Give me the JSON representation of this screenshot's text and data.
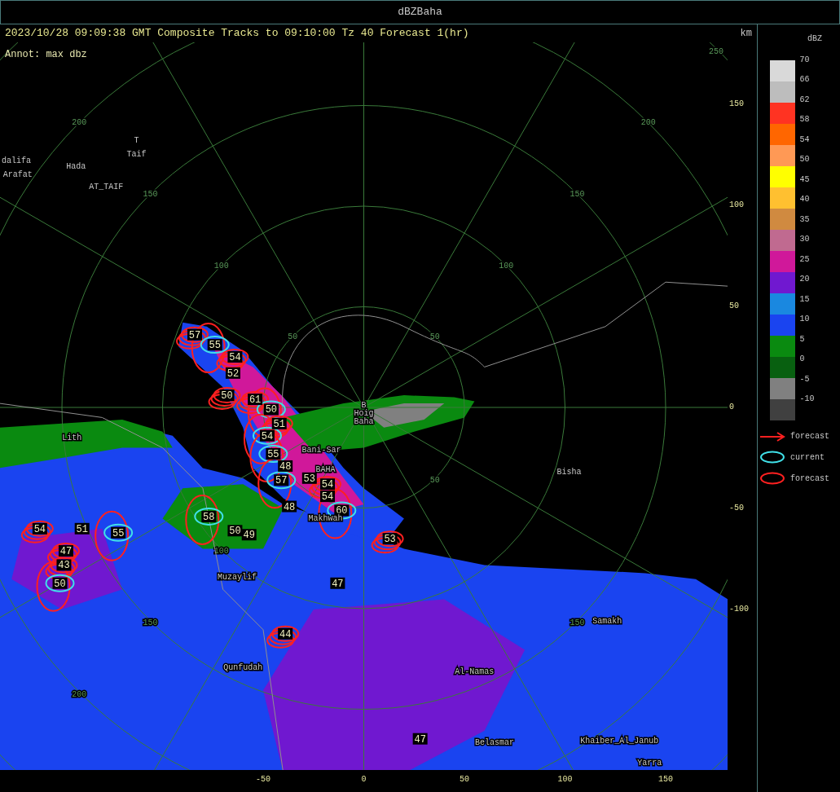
{
  "window": {
    "title": "dBZBaha"
  },
  "header": {
    "text": "2023/10/28 09:09:38 GMT Composite Tracks to 09:10:00 Tz 40 Forecast 1(hr)",
    "unit": "km"
  },
  "annotation": "Annot: max dbz",
  "rings": [
    {
      "labels": [
        "250"
      ]
    },
    {
      "labels": [
        "200",
        "200",
        "200"
      ]
    },
    {
      "labels": [
        "150",
        "150",
        "150",
        "150"
      ]
    },
    {
      "labels": [
        "100",
        "100",
        "100"
      ]
    },
    {
      "labels": [
        "50",
        "50",
        "50"
      ]
    }
  ],
  "towns": [
    "T",
    "Taif",
    "dalifa",
    "Arafat",
    "Hada",
    "AT_TAIF",
    "Lith",
    "B",
    "Hoig",
    "Baha",
    "Bani-Sar",
    "BAHA",
    "Makhwah",
    "Bisha",
    "Muzaylif",
    "Qunfudah",
    "Al-Namas",
    "Samakh",
    "Belasmar",
    "Khaiber_Al_Janub",
    "Yarra"
  ],
  "cells": [
    {
      "dbz": "57",
      "current": false,
      "forecast": true
    },
    {
      "dbz": "55",
      "current": true,
      "forecast": true
    },
    {
      "dbz": "54",
      "current": false,
      "forecast": true
    },
    {
      "dbz": "52",
      "current": false,
      "forecast": false
    },
    {
      "dbz": "50",
      "current": false,
      "forecast": true
    },
    {
      "dbz": "61",
      "current": false,
      "forecast": true
    },
    {
      "dbz": "50",
      "current": true,
      "forecast": true
    },
    {
      "dbz": "51",
      "current": false,
      "forecast": true
    },
    {
      "dbz": "54",
      "current": true,
      "forecast": true
    },
    {
      "dbz": "55",
      "current": true,
      "forecast": true
    },
    {
      "dbz": "48",
      "current": false,
      "forecast": false
    },
    {
      "dbz": "57",
      "current": true,
      "forecast": true
    },
    {
      "dbz": "53",
      "current": false,
      "forecast": false
    },
    {
      "dbz": "54",
      "current": false,
      "forecast": true
    },
    {
      "dbz": "54",
      "current": false,
      "forecast": false
    },
    {
      "dbz": "48",
      "current": false,
      "forecast": false
    },
    {
      "dbz": "60",
      "current": true,
      "forecast": true
    },
    {
      "dbz": "58",
      "current": true,
      "forecast": true
    },
    {
      "dbz": "50",
      "current": false,
      "forecast": false
    },
    {
      "dbz": "49",
      "current": false,
      "forecast": false
    },
    {
      "dbz": "53",
      "current": false,
      "forecast": true
    },
    {
      "dbz": "54",
      "current": false,
      "forecast": true
    },
    {
      "dbz": "51",
      "current": false,
      "forecast": false
    },
    {
      "dbz": "55",
      "current": true,
      "forecast": true
    },
    {
      "dbz": "47",
      "current": false,
      "forecast": true
    },
    {
      "dbz": "43",
      "current": false,
      "forecast": true
    },
    {
      "dbz": "50",
      "current": true,
      "forecast": true
    },
    {
      "dbz": "47",
      "current": false,
      "forecast": false
    },
    {
      "dbz": "44",
      "current": false,
      "forecast": true
    },
    {
      "dbz": "47",
      "current": false,
      "forecast": false
    }
  ],
  "right_axis": [
    "150",
    "100",
    "50",
    "0",
    "-50",
    "-100"
  ],
  "bottom_axis": [
    "-50",
    "0",
    "50",
    "100",
    "150"
  ],
  "legend": {
    "title": "dBZ",
    "bins": [
      {
        "color": "#d9d9d9"
      },
      {
        "color": "#bdbdbd"
      },
      {
        "color": "#ff3322"
      },
      {
        "color": "#ff6600"
      },
      {
        "color": "#ff9955"
      },
      {
        "color": "#ffff00"
      },
      {
        "color": "#ffc030"
      },
      {
        "color": "#d08a40"
      },
      {
        "color": "#c06a90"
      },
      {
        "color": "#d0189a"
      },
      {
        "color": "#7018d0"
      },
      {
        "color": "#1a88e0"
      },
      {
        "color": "#1a44f0"
      },
      {
        "color": "#0a8a10"
      },
      {
        "color": "#086010"
      },
      {
        "color": "#808080"
      },
      {
        "color": "#404040"
      }
    ],
    "ticks": [
      "70",
      "66",
      "62",
      "58",
      "54",
      "50",
      "45",
      "40",
      "35",
      "30",
      "25",
      "20",
      "15",
      "10",
      "5",
      "0",
      "-5",
      "-10"
    ],
    "keys": [
      {
        "kind": "arrow",
        "label": "forecast"
      },
      {
        "kind": "current",
        "label": "current"
      },
      {
        "kind": "forecast",
        "label": "forecast"
      }
    ]
  }
}
